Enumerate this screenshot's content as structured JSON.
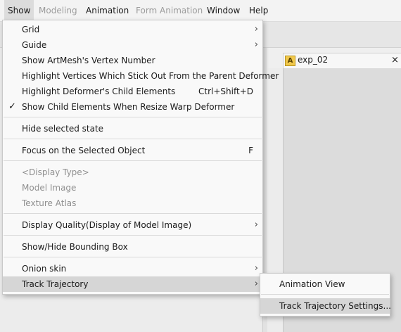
{
  "menubar": {
    "items": [
      {
        "label": "Show"
      },
      {
        "label": "Modeling"
      },
      {
        "label": "Animation"
      },
      {
        "label": "Form Animation"
      },
      {
        "label": "Window"
      },
      {
        "label": "Help"
      }
    ]
  },
  "document_tab": {
    "label": "exp_02",
    "icon": "A",
    "close": "×"
  },
  "show_menu": {
    "items": [
      {
        "label": "Grid",
        "arrow": "›"
      },
      {
        "label": "Guide",
        "arrow": "›"
      },
      {
        "label": "Show ArtMesh's Vertex Number"
      },
      {
        "label": "Highlight Vertices Which Stick Out From the Parent Deformer"
      },
      {
        "label": "Highlight Deformer's Child Elements",
        "shortcut": "Ctrl+Shift+D"
      },
      {
        "label": "Show Child Elements When Resize Warp Deformer",
        "check": "✓"
      },
      {
        "label": "Hide selected state"
      },
      {
        "label": "Focus on the Selected Object",
        "shortcut": "F"
      },
      {
        "label": "<Display Type>"
      },
      {
        "label": "Model Image"
      },
      {
        "label": "Texture Atlas"
      },
      {
        "label": "Display Quality(Display of Model Image)",
        "arrow": "›"
      },
      {
        "label": "Show/Hide Bounding Box"
      },
      {
        "label": "Onion skin",
        "arrow": "›"
      },
      {
        "label": "Track Trajectory",
        "arrow": "›"
      }
    ]
  },
  "track_trajectory_submenu": {
    "items": [
      {
        "label": "Animation View"
      },
      {
        "label": "Track Trajectory Settings..."
      }
    ]
  }
}
